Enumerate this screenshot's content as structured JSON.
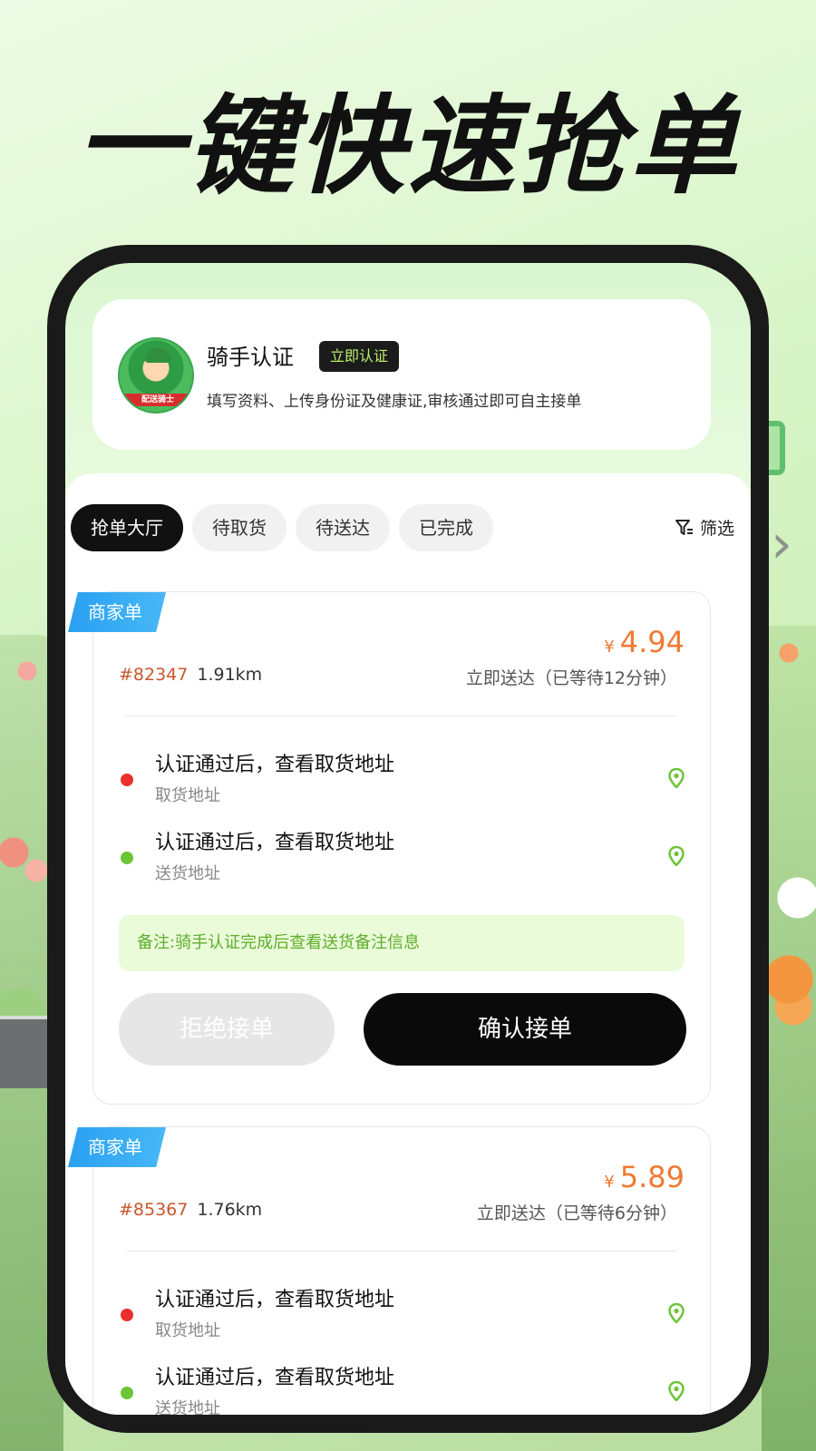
{
  "headline": "一键快速抢单",
  "rider": {
    "title": "骑手认证",
    "badge": "立即认证",
    "description": "填写资料、上传身份证及健康证,审核通过即可自主接单",
    "avatar_label": "配送骑士"
  },
  "tabs": [
    {
      "label": "抢单大厅",
      "active": true
    },
    {
      "label": "待取货",
      "active": false
    },
    {
      "label": "待送达",
      "active": false
    },
    {
      "label": "已完成",
      "active": false
    }
  ],
  "filter_label": "筛选",
  "orders": [
    {
      "tag": "商家单",
      "currency": "¥",
      "price": "4.94",
      "number": "#82347",
      "distance": "1.91km",
      "wait": "立即送达（已等待12分钟）",
      "pickup": {
        "main": "认证通过后，查看取货地址",
        "sub": "取货地址"
      },
      "dropoff": {
        "main": "认证通过后，查看取货地址",
        "sub": "送货地址"
      },
      "note": "备注:骑手认证完成后查看送货备注信息",
      "reject_label": "拒绝接单",
      "confirm_label": "确认接单"
    },
    {
      "tag": "商家单",
      "currency": "¥",
      "price": "5.89",
      "number": "#85367",
      "distance": "1.76km",
      "wait": "立即送达（已等待6分钟）",
      "pickup": {
        "main": "认证通过后，查看取货地址",
        "sub": "取货地址"
      },
      "dropoff": {
        "main": "认证通过后，查看取货地址",
        "sub": "送货地址"
      }
    }
  ],
  "colors": {
    "accent_green": "#b9f06a",
    "price_orange": "#ef7a33",
    "tag_blue": "#2aa0f1",
    "note_green": "#5fae2c"
  }
}
